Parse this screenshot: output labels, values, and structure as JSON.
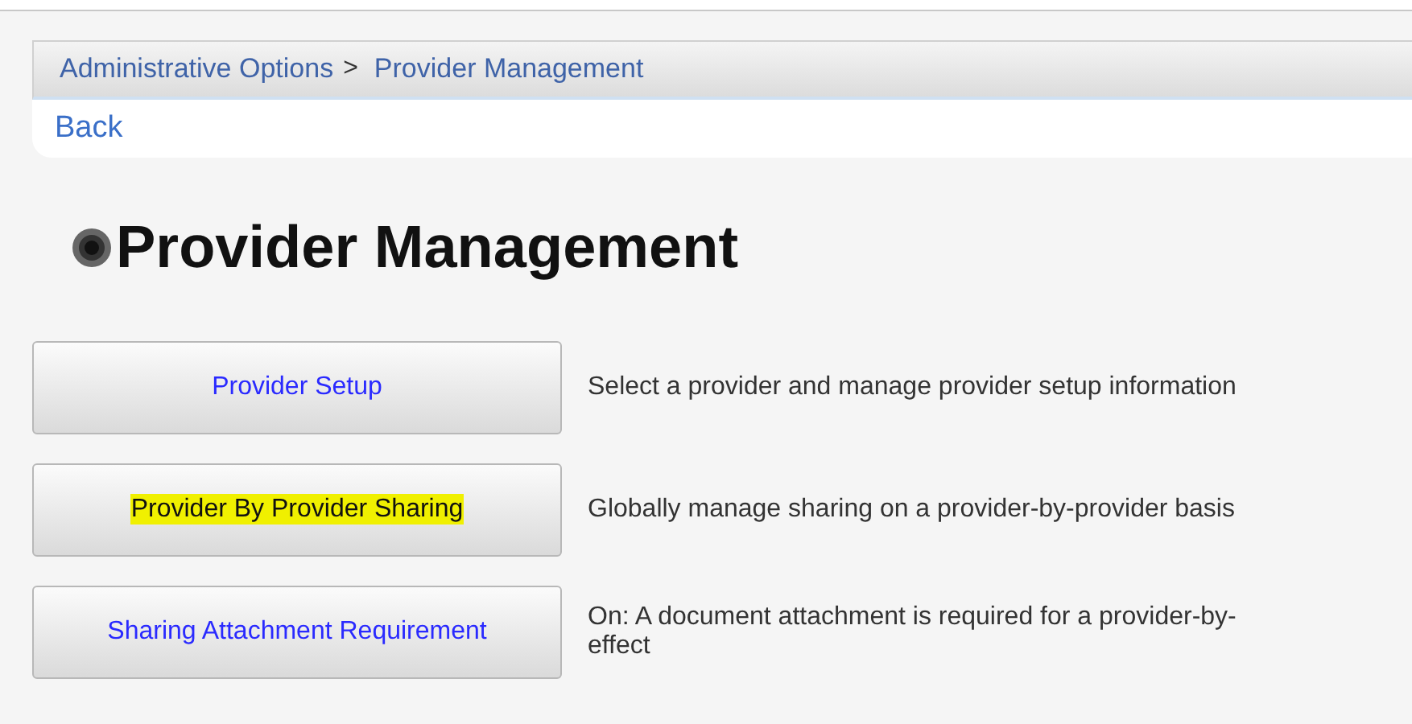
{
  "breadcrumb": {
    "items": [
      "Administrative Options",
      "Provider Management"
    ],
    "separator": ">"
  },
  "back_link": "Back",
  "title": "Provider Management",
  "options": [
    {
      "label": "Provider Setup",
      "highlighted": false,
      "description_lines": [
        "Select a provider and manage provider setup information"
      ]
    },
    {
      "label": "Provider By Provider Sharing",
      "highlighted": true,
      "description_lines": [
        "Globally manage sharing on a provider-by-provider basis"
      ]
    },
    {
      "label": "Sharing Attachment Requirement",
      "highlighted": false,
      "description_lines": [
        "On: A document attachment is required for a provider-by-",
        "effect"
      ]
    }
  ]
}
